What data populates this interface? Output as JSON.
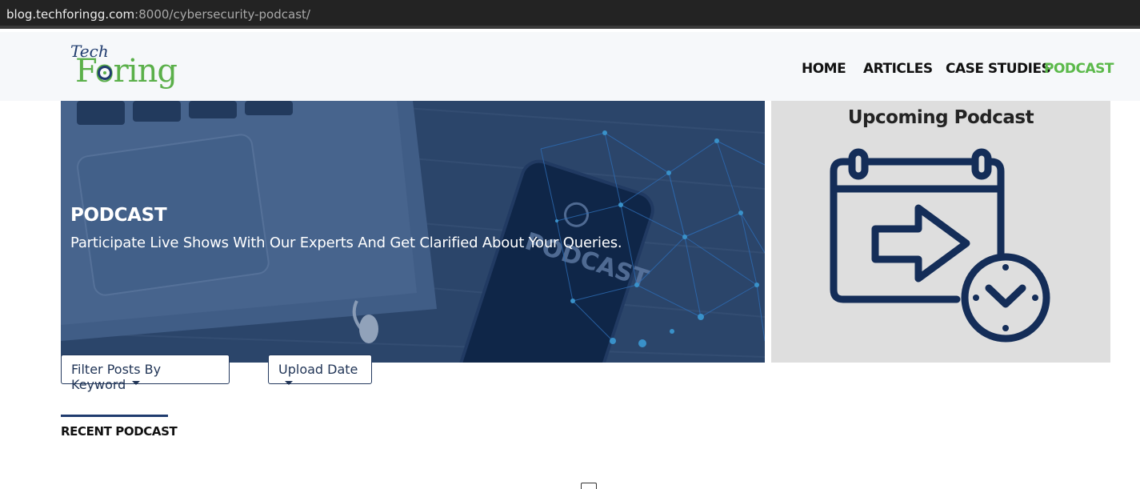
{
  "browser": {
    "url_host": "blog.techforingg.com",
    "url_rest": ":8000/cybersecurity-podcast/"
  },
  "header": {
    "logo_top": "Tech",
    "logo_main": "Foring",
    "nav": [
      {
        "label": "HOME"
      },
      {
        "label": "ARTICLES"
      },
      {
        "label": "CASE STUDIES"
      },
      {
        "label": "PODCAST",
        "active": true
      }
    ],
    "active_color": "#5bb94a"
  },
  "hero": {
    "title": "PODCAST",
    "subtitle": "Participate Live Shows With Our Experts And Get Clarified About Your Queries."
  },
  "upcoming": {
    "title": "Upcoming Podcast",
    "icon": "calendar-schedule-icon"
  },
  "filters": {
    "keyword_label": "Filter Posts By Keyword",
    "date_label": "Upload Date"
  },
  "recent": {
    "title": "RECENT PODCAST"
  },
  "colors": {
    "brand_navy": "#1f3b6e",
    "brand_green": "#5bb04a"
  }
}
